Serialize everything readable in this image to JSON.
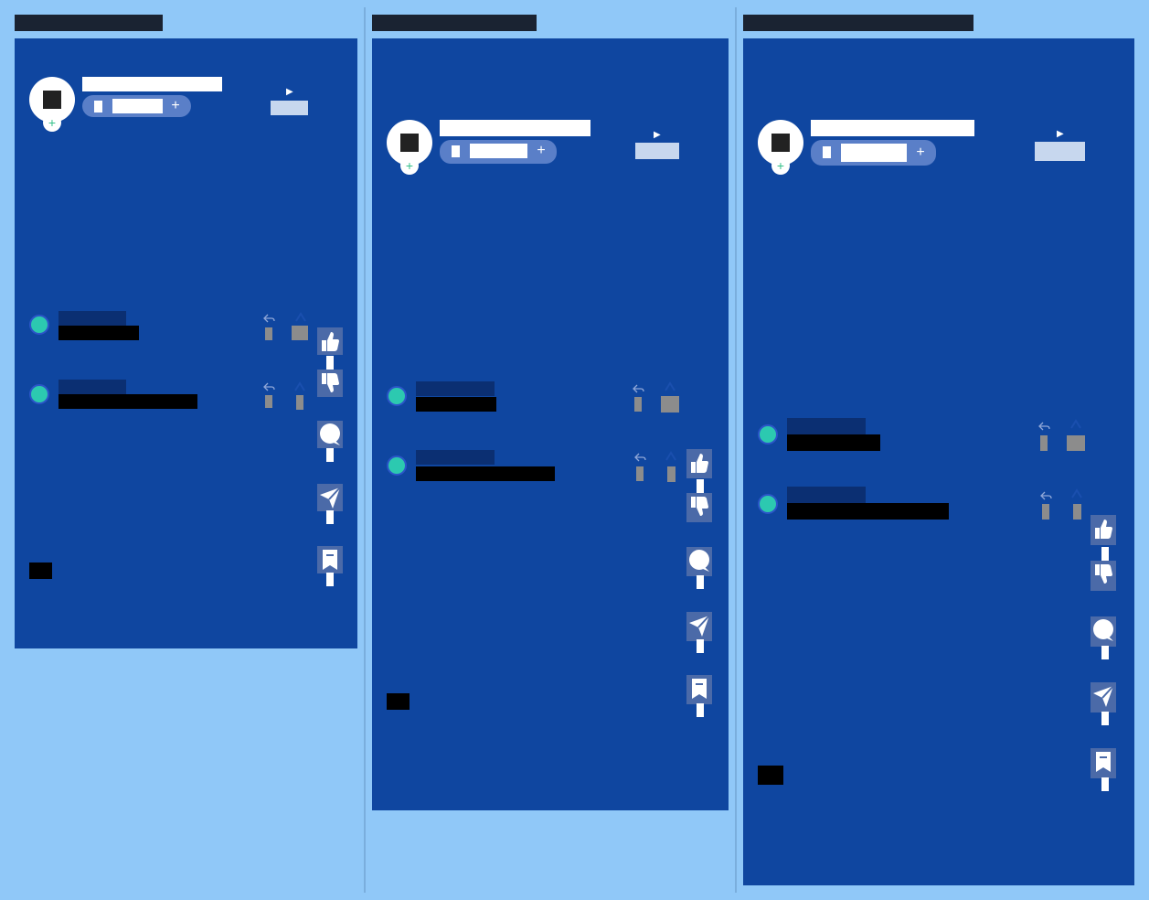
{
  "app": {
    "background": "#90c8f8",
    "panel_color": "#0f46a0",
    "accent": "#2cc9b0"
  },
  "icons": {
    "add": "+",
    "music": "▶",
    "like": "thumbs-up-icon",
    "dislike": "thumbs-down-icon",
    "comment": "comment-bubble-icon",
    "share": "paper-plane-icon",
    "save": "bookmark-icon",
    "reply": "reply-arrow-icon"
  },
  "panels": [
    {
      "name": "panel-1",
      "follow_plus": "+"
    },
    {
      "name": "panel-2",
      "follow_plus": "+"
    },
    {
      "name": "panel-3",
      "follow_plus": "+"
    }
  ]
}
